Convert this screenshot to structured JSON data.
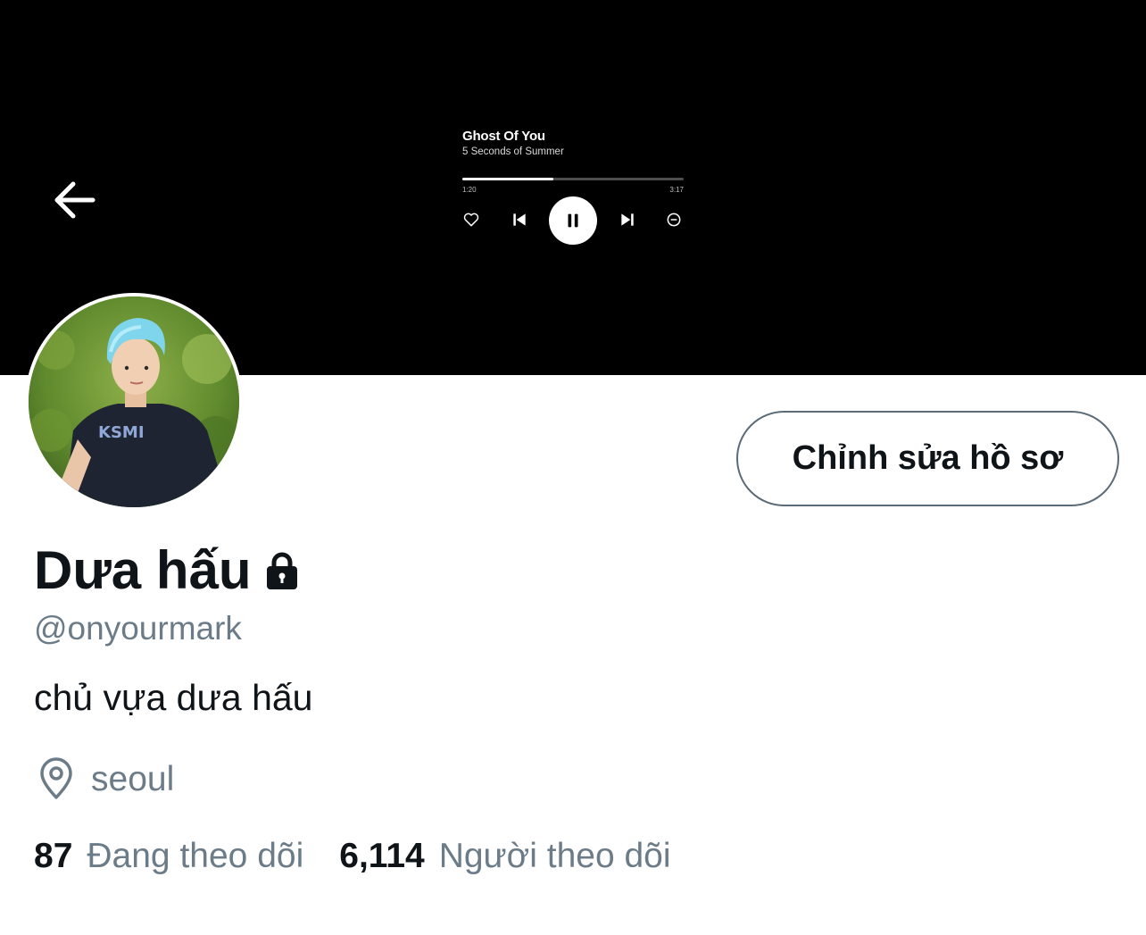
{
  "banner": {
    "background": "#000000",
    "player": {
      "song_title": "Ghost Of You",
      "artist": "5 Seconds of Summer",
      "time_elapsed": "1:20",
      "time_total": "3:17",
      "progress_fraction": 0.41,
      "icons": [
        "heart-icon",
        "previous-icon",
        "pause-icon",
        "next-icon",
        "minus-circle-icon"
      ]
    }
  },
  "nav": {
    "back_icon": "arrow-left-icon"
  },
  "profile": {
    "display_name": "Dưa hấu",
    "protected_icon": "lock-icon",
    "handle": "@onyourmark",
    "bio": "chủ vựa dưa hấu",
    "location": "seoul",
    "location_icon": "location-pin-icon",
    "edit_button_label": "Chỉnh sửa hồ sơ",
    "stats": [
      {
        "count": "87",
        "label": "Đang theo dõi"
      },
      {
        "count": "6,114",
        "label": "Người theo dõi"
      }
    ]
  },
  "colors": {
    "text_primary": "#0f1419",
    "text_secondary": "#6b7b88",
    "button_border": "#5b6b78"
  }
}
